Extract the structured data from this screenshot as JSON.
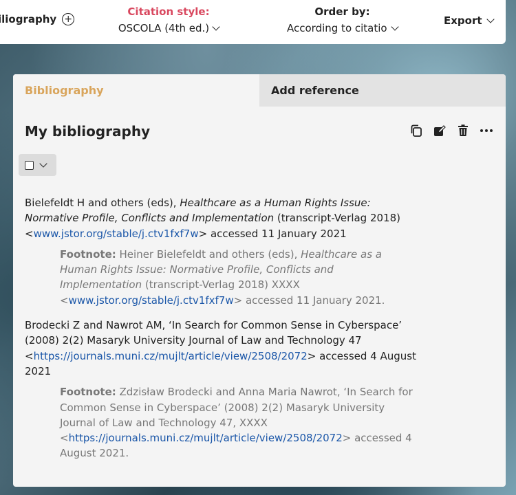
{
  "topbar": {
    "bibliography_title": "iliography",
    "citation_style_label": "Citation style:",
    "citation_style_value": "OSCOLA (4th ed.)",
    "order_by_label": "Order by:",
    "order_by_value": "According to citation style",
    "export_label": "Export"
  },
  "tabs": [
    {
      "label": "Bibliography"
    },
    {
      "label": "Add reference"
    }
  ],
  "main": {
    "heading": "My bibliography"
  },
  "entries": [
    {
      "ref_pre": "Bielefeldt H and others (eds), ",
      "ref_title": "Healthcare as a Human Rights Issue: Normative Profile, Conflicts and Implementation",
      "ref_mid": " (transcript-Verlag 2018) <",
      "ref_link": "www.jstor.org/stable/j.ctv1fxf7w",
      "ref_post": "> accessed 11 January 2021",
      "foot_label": "Footnote:",
      "foot_pre": " Heiner Bielefeldt and others (eds), ",
      "foot_title": "Healthcare as a Human Rights Issue: Normative Profile, Conflicts and Implementation",
      "foot_mid": " (transcript-Verlag 2018) XXXX <",
      "foot_link": "www.jstor.org/stable/j.ctv1fxf7w",
      "foot_post": "> accessed 11 January 2021."
    },
    {
      "ref_pre": "Brodecki Z and Nawrot AM, ‘In Search for Common Sense in Cyberspace’ (2008) 2(2) Masaryk University Journal of Law and Technology 47 <",
      "ref_link": "https://journals.muni.cz/mujlt/article/view/2508/2072",
      "ref_post": "> accessed 4 August 2021",
      "foot_label": "Footnote:",
      "foot_pre": " Zdzisław Brodecki and Anna Maria Nawrot, ‘In Search for Common Sense in Cyberspace’ (2008) 2(2) Masaryk University Journal of Law and Technology 47, XXXX <",
      "foot_link": "https://journals.muni.cz/mujlt/article/view/2508/2072",
      "foot_post": "> accessed 4 August 2021."
    }
  ],
  "icons": [
    "add-circle-icon",
    "chevron-down-icon",
    "copy-icon",
    "edit-icon",
    "trash-icon",
    "more-icon",
    "checkbox-icon"
  ],
  "colors": {
    "accent": "#d9485f",
    "tab_active": "#d9a55c",
    "link": "#1a56a8"
  }
}
